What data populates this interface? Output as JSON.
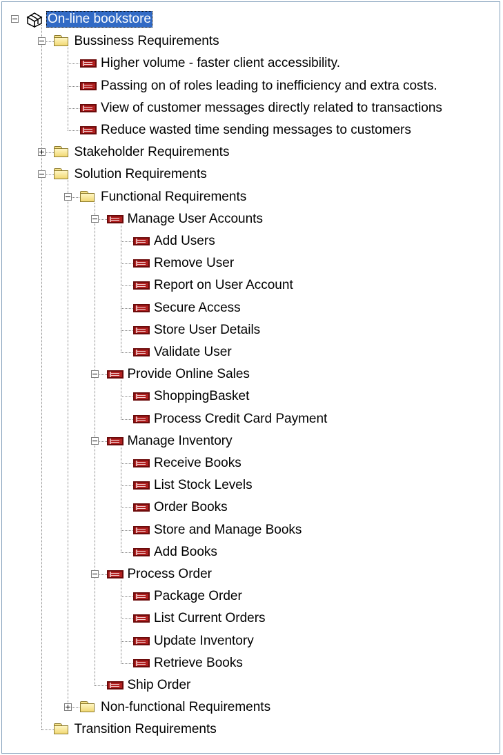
{
  "tree": {
    "nodes": [
      {
        "label": "On-line bookstore",
        "level": 0,
        "icon": "package-icon",
        "expander": "expanded",
        "selected": true
      },
      {
        "label": "Bussiness Requirements",
        "level": 1,
        "icon": "folder-icon",
        "expander": "expanded"
      },
      {
        "label": "Higher volume - faster client accessibility.",
        "level": 2,
        "icon": "requirement-icon"
      },
      {
        "label": "Passing on of roles leading to inefficiency and extra costs.",
        "level": 2,
        "icon": "requirement-icon"
      },
      {
        "label": "View of customer messages directly related to transactions",
        "level": 2,
        "icon": "requirement-icon"
      },
      {
        "label": "Reduce wasted time sending messages to customers",
        "level": 2,
        "icon": "requirement-icon"
      },
      {
        "label": "Stakeholder Requirements",
        "level": 1,
        "icon": "folder-icon",
        "expander": "collapsed"
      },
      {
        "label": "Solution Requirements",
        "level": 1,
        "icon": "folder-icon",
        "expander": "expanded"
      },
      {
        "label": "Functional Requirements",
        "level": 2,
        "icon": "folder-icon",
        "expander": "expanded"
      },
      {
        "label": "Manage User Accounts",
        "level": 3,
        "icon": "requirement-icon",
        "expander": "expanded"
      },
      {
        "label": "Add Users",
        "level": 4,
        "icon": "requirement-icon"
      },
      {
        "label": "Remove User",
        "level": 4,
        "icon": "requirement-icon"
      },
      {
        "label": "Report on User Account",
        "level": 4,
        "icon": "requirement-icon"
      },
      {
        "label": "Secure Access",
        "level": 4,
        "icon": "requirement-icon"
      },
      {
        "label": "Store User Details",
        "level": 4,
        "icon": "requirement-icon"
      },
      {
        "label": "Validate User",
        "level": 4,
        "icon": "requirement-icon"
      },
      {
        "label": "Provide Online Sales",
        "level": 3,
        "icon": "requirement-icon",
        "expander": "expanded"
      },
      {
        "label": "ShoppingBasket",
        "level": 4,
        "icon": "requirement-icon"
      },
      {
        "label": "Process Credit Card Payment",
        "level": 4,
        "icon": "requirement-icon"
      },
      {
        "label": "Manage Inventory",
        "level": 3,
        "icon": "requirement-icon",
        "expander": "expanded"
      },
      {
        "label": "Receive Books",
        "level": 4,
        "icon": "requirement-icon"
      },
      {
        "label": "List Stock Levels",
        "level": 4,
        "icon": "requirement-icon"
      },
      {
        "label": "Order Books",
        "level": 4,
        "icon": "requirement-icon"
      },
      {
        "label": "Store and Manage Books",
        "level": 4,
        "icon": "requirement-icon"
      },
      {
        "label": "Add Books",
        "level": 4,
        "icon": "requirement-icon"
      },
      {
        "label": "Process Order",
        "level": 3,
        "icon": "requirement-icon",
        "expander": "expanded"
      },
      {
        "label": "Package Order",
        "level": 4,
        "icon": "requirement-icon"
      },
      {
        "label": "List Current Orders",
        "level": 4,
        "icon": "requirement-icon"
      },
      {
        "label": "Update Inventory",
        "level": 4,
        "icon": "requirement-icon"
      },
      {
        "label": "Retrieve Books",
        "level": 4,
        "icon": "requirement-icon"
      },
      {
        "label": "Ship Order",
        "level": 3,
        "icon": "requirement-icon"
      },
      {
        "label": "Non-functional Requirements",
        "level": 2,
        "icon": "folder-icon",
        "expander": "collapsed"
      },
      {
        "label": "Transition Requirements",
        "level": 1,
        "icon": "folder-icon"
      }
    ]
  },
  "colors": {
    "selection": "#316ac5",
    "requirement_icon": "#b02020",
    "folder_icon": "#f1d873"
  }
}
